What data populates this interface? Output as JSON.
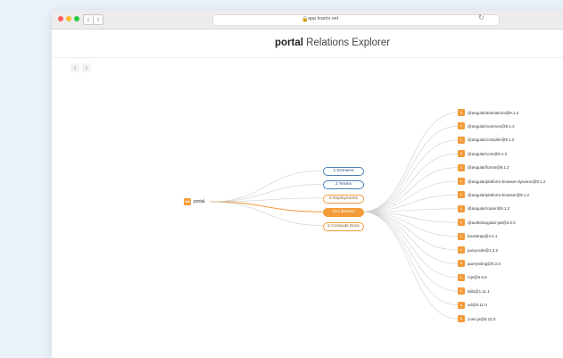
{
  "browser": {
    "url": "app.leanix.net"
  },
  "header": {
    "brand_name": "portal",
    "brand_rest": " Relations Explorer"
  },
  "history": {
    "prev_symbol": "‹",
    "next_symbol": "›"
  },
  "graph": {
    "root": {
      "label": "portal",
      "badge": "AS"
    },
    "categories": [
      {
        "label": "1 Domains",
        "style": "blue"
      },
      {
        "label": "2 Teams",
        "style": "blue"
      },
      {
        "label": "5 Deployments",
        "style": "orange"
      },
      {
        "label": "18 Libraries",
        "style": "active"
      },
      {
        "label": "5 Compute Envs",
        "style": "orange"
      }
    ],
    "libraries": [
      "@angular/animations@9.1.2",
      "@angular/common@9.1.2",
      "@angular/compiler@9.1.2",
      "@angular/core@9.1.2",
      "@angular/forms@9.1.2",
      "@angular/platform-browser-dynamic@9.1.2",
      "@angular/platform-browser@9.1.2",
      "@angular/router@9.1.2",
      "@auth0/angular-jwt@4.0.0",
      "bootstrap@4.4.1",
      "punycode@1.3.2",
      "querystring@0.2.0",
      "rxjs@6.5.5",
      "tslib@1.11.1",
      "url@0.11.0",
      "zone.js@0.10.3"
    ],
    "library_badge": "L"
  },
  "colors": {
    "accent": "#f39b38",
    "category_border": "#4a7fb5",
    "link": "#cfcfcf"
  }
}
